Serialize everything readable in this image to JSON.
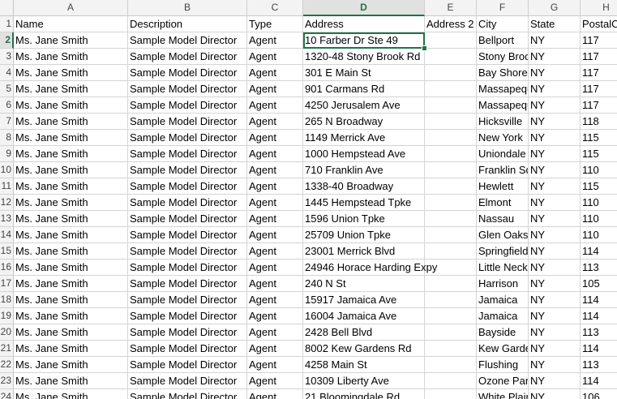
{
  "columns": [
    "A",
    "B",
    "C",
    "D",
    "E",
    "F",
    "G",
    "H"
  ],
  "active_column": "D",
  "active_row": "2",
  "header": {
    "row_number": "1",
    "cells": [
      "Name",
      "Description",
      "Type",
      "Address",
      "Address 2",
      "City",
      "State",
      "PostalCode"
    ]
  },
  "rows": [
    {
      "n": "2",
      "name": "Ms. Jane Smith",
      "description": "Sample Model Director",
      "type": "Agent",
      "address": "10 Farber Dr Ste 49",
      "address2": "",
      "city": "Bellport",
      "state": "NY",
      "postal": "117"
    },
    {
      "n": "3",
      "name": "Ms. Jane Smith",
      "description": "Sample Model Director",
      "type": "Agent",
      "address": "1320-48 Stony Brook Rd",
      "address2": "",
      "city": "Stony Brook",
      "state": "NY",
      "postal": "117"
    },
    {
      "n": "4",
      "name": "Ms. Jane Smith",
      "description": "Sample Model Director",
      "type": "Agent",
      "address": "301 E Main St",
      "address2": "",
      "city": "Bay Shore",
      "state": "NY",
      "postal": "117"
    },
    {
      "n": "5",
      "name": "Ms. Jane Smith",
      "description": "Sample Model Director",
      "type": "Agent",
      "address": "901 Carmans Rd",
      "address2": "",
      "city": "Massapequa",
      "state": "NY",
      "postal": "117"
    },
    {
      "n": "6",
      "name": "Ms. Jane Smith",
      "description": "Sample Model Director",
      "type": "Agent",
      "address": "4250 Jerusalem Ave",
      "address2": "",
      "city": "Massapequa",
      "state": "NY",
      "postal": "117"
    },
    {
      "n": "7",
      "name": "Ms. Jane Smith",
      "description": "Sample Model Director",
      "type": "Agent",
      "address": "265 N Broadway",
      "address2": "",
      "city": "Hicksville",
      "state": "NY",
      "postal": "118"
    },
    {
      "n": "8",
      "name": "Ms. Jane Smith",
      "description": "Sample Model Director",
      "type": "Agent",
      "address": "1149 Merrick Ave",
      "address2": "",
      "city": "New York",
      "state": "NY",
      "postal": "115"
    },
    {
      "n": "9",
      "name": "Ms. Jane Smith",
      "description": "Sample Model Director",
      "type": "Agent",
      "address": "1000 Hempstead Ave",
      "address2": "",
      "city": "Uniondale",
      "state": "NY",
      "postal": "115"
    },
    {
      "n": "10",
      "name": "Ms. Jane Smith",
      "description": "Sample Model Director",
      "type": "Agent",
      "address": "710 Franklin Ave",
      "address2": "",
      "city": "Franklin Square",
      "state": "NY",
      "postal": "110"
    },
    {
      "n": "11",
      "name": "Ms. Jane Smith",
      "description": "Sample Model Director",
      "type": "Agent",
      "address": "1338-40 Broadway",
      "address2": "",
      "city": "Hewlett",
      "state": "NY",
      "postal": "115"
    },
    {
      "n": "12",
      "name": "Ms. Jane Smith",
      "description": "Sample Model Director",
      "type": "Agent",
      "address": "1445 Hempstead Tpke",
      "address2": "",
      "city": "Elmont",
      "state": "NY",
      "postal": "110"
    },
    {
      "n": "13",
      "name": "Ms. Jane Smith",
      "description": "Sample Model Director",
      "type": "Agent",
      "address": "1596 Union Tpke",
      "address2": "",
      "city": "Nassau",
      "state": "NY",
      "postal": "110"
    },
    {
      "n": "14",
      "name": "Ms. Jane Smith",
      "description": "Sample Model Director",
      "type": "Agent",
      "address": "25709 Union Tpke",
      "address2": "",
      "city": "Glen Oaks",
      "state": "NY",
      "postal": "110"
    },
    {
      "n": "15",
      "name": "Ms. Jane Smith",
      "description": "Sample Model Director",
      "type": "Agent",
      "address": "23001 Merrick Blvd",
      "address2": "",
      "city": "Springfield",
      "state": "NY",
      "postal": "114"
    },
    {
      "n": "16",
      "name": "Ms. Jane Smith",
      "description": "Sample Model Director",
      "type": "Agent",
      "address": "24946 Horace Harding Expy",
      "address2": "",
      "city": "Little Neck",
      "state": "NY",
      "postal": "113"
    },
    {
      "n": "17",
      "name": "Ms. Jane Smith",
      "description": "Sample Model Director",
      "type": "Agent",
      "address": "240 N St",
      "address2": "",
      "city": "Harrison",
      "state": "NY",
      "postal": "105"
    },
    {
      "n": "18",
      "name": "Ms. Jane Smith",
      "description": "Sample Model Director",
      "type": "Agent",
      "address": "15917 Jamaica Ave",
      "address2": "",
      "city": "Jamaica",
      "state": "NY",
      "postal": "114"
    },
    {
      "n": "19",
      "name": "Ms. Jane Smith",
      "description": "Sample Model Director",
      "type": "Agent",
      "address": "16004 Jamaica Ave",
      "address2": "",
      "city": "Jamaica",
      "state": "NY",
      "postal": "114"
    },
    {
      "n": "20",
      "name": "Ms. Jane Smith",
      "description": "Sample Model Director",
      "type": "Agent",
      "address": "2428 Bell Blvd",
      "address2": "",
      "city": "Bayside",
      "state": "NY",
      "postal": "113"
    },
    {
      "n": "21",
      "name": "Ms. Jane Smith",
      "description": "Sample Model Director",
      "type": "Agent",
      "address": "8002 Kew Gardens Rd",
      "address2": "",
      "city": "Kew Gardens",
      "state": "NY",
      "postal": "114"
    },
    {
      "n": "22",
      "name": "Ms. Jane Smith",
      "description": "Sample Model Director",
      "type": "Agent",
      "address": "4258 Main St",
      "address2": "",
      "city": "Flushing",
      "state": "NY",
      "postal": "113"
    },
    {
      "n": "23",
      "name": "Ms. Jane Smith",
      "description": "Sample Model Director",
      "type": "Agent",
      "address": "10309 Liberty Ave",
      "address2": "",
      "city": "Ozone Park",
      "state": "NY",
      "postal": "114"
    },
    {
      "n": "24",
      "name": "Ms. Jane Smith",
      "description": "Sample Model Director",
      "type": "Agent",
      "address": "21 Bloomingdale Rd",
      "address2": "",
      "city": "White Plains",
      "state": "NY",
      "postal": "106"
    }
  ],
  "colors": {
    "accent": "#217346",
    "header_bg": "#f3f3f3",
    "grid": "#d4d4d4"
  }
}
